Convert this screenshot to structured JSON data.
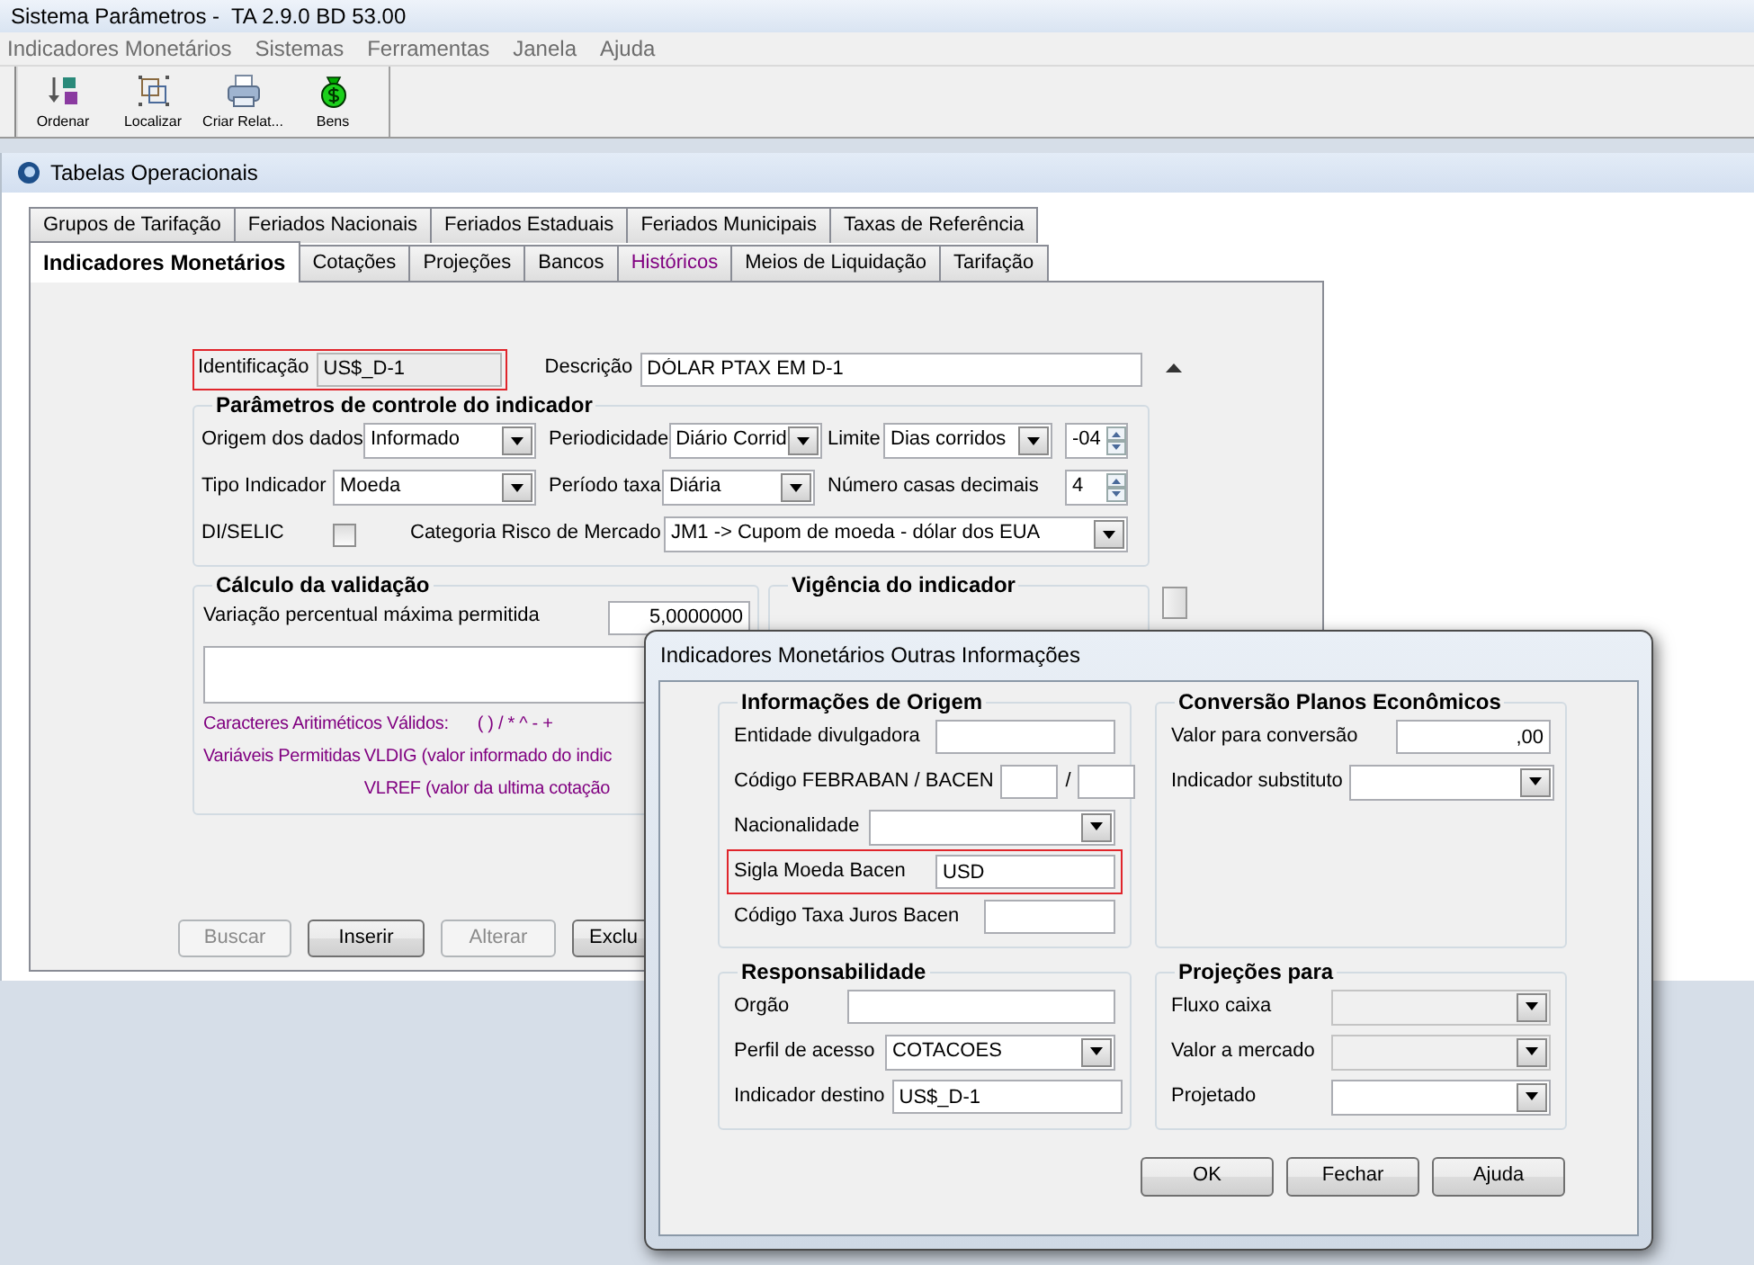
{
  "app_title": "Sistema Parâmetros -  TA 2.9.0 BD 53.00",
  "menu": [
    "Indicadores Monetários",
    "Sistemas",
    "Ferramentas",
    "Janela",
    "Ajuda"
  ],
  "toolbar": [
    {
      "label": "Ordenar",
      "kind": "sort"
    },
    {
      "label": "Localizar",
      "kind": "find"
    },
    {
      "label": "Criar Relat...",
      "kind": "print"
    },
    {
      "label": "Bens",
      "kind": "money"
    }
  ],
  "child_window": {
    "title": "Tabelas Operacionais"
  },
  "tab_rows": [
    [
      {
        "label": "Grupos de Tarifação",
        "selected": false,
        "visited": false
      },
      {
        "label": "Feriados Nacionais",
        "selected": false,
        "visited": false
      },
      {
        "label": "Feriados Estaduais",
        "selected": false,
        "visited": false
      },
      {
        "label": "Feriados Municipais",
        "selected": false,
        "visited": false
      },
      {
        "label": "Taxas de Referência",
        "selected": false,
        "visited": false
      }
    ],
    [
      {
        "label": "Indicadores Monetários",
        "selected": true,
        "visited": false
      },
      {
        "label": "Cotações",
        "selected": false,
        "visited": false
      },
      {
        "label": "Projeções",
        "selected": false,
        "visited": false
      },
      {
        "label": "Bancos",
        "selected": false,
        "visited": false
      },
      {
        "label": "Históricos",
        "selected": false,
        "visited": true
      },
      {
        "label": "Meios de Liquidação",
        "selected": false,
        "visited": false
      },
      {
        "label": "Tarifação",
        "selected": false,
        "visited": false
      }
    ]
  ],
  "header_fields": [
    {
      "kind": "text",
      "label": "Identificação",
      "value": "US$_D-1",
      "readonly": true,
      "highlighted": true
    },
    {
      "kind": "text",
      "label": "Descrição",
      "value": "DÓLAR PTAX EM D-1",
      "readonly": false,
      "highlighted": false
    }
  ],
  "parameters": {
    "title": "Parâmetros de controle do indicador",
    "rows": [
      [
        {
          "kind": "select",
          "label": "Origem dos dados",
          "value": "Informado"
        },
        {
          "kind": "select",
          "label": "Periodicidade",
          "value": "Diário Corrid"
        },
        {
          "kind": "select",
          "label": "Limite",
          "value": "Dias corridos"
        },
        {
          "kind": "spin",
          "value": "-04"
        }
      ],
      [
        {
          "kind": "select",
          "label": "Tipo Indicador",
          "value": "Moeda"
        },
        {
          "kind": "select",
          "label": "Período taxa",
          "value": "Diária"
        },
        {
          "kind": "label",
          "label": "Número casas decimais"
        },
        {
          "kind": "spin",
          "value": "4"
        }
      ],
      [
        {
          "kind": "checkbox",
          "label": "DI/SELIC",
          "checked": false
        },
        {
          "kind": "select",
          "label": "Categoria Risco de Mercado",
          "value": "JM1 -> Cupom de moeda - dólar dos EUA"
        }
      ]
    ]
  },
  "validation": {
    "title": "Cálculo da validação",
    "field": {
      "label": "Variação percentual máxima permitida",
      "value": "5,0000000"
    },
    "notes": [
      {
        "kind": "inline",
        "label": "Caracteres Aritiméticos Válidos:",
        "text": "( ) / * ^ - +"
      },
      {
        "kind": "grid",
        "label": "Variáveis Permitidas",
        "text": "VLDIG  (valor informado do indic"
      },
      {
        "kind": "grid",
        "text": "VLREF (valor da ultima cotação"
      }
    ]
  },
  "validity": {
    "title": "Vigência do indicador"
  },
  "buttons": [
    {
      "label": "Buscar",
      "disabled": true
    },
    {
      "label": "Inserir",
      "disabled": false
    },
    {
      "label": "Alterar",
      "disabled": true
    },
    {
      "label": "Exclu",
      "disabled": false
    }
  ],
  "dialog": {
    "title": "Indicadores Monetários Outras Informações",
    "groups": [
      {
        "title": "Informações de Origem",
        "fields": [
          {
            "kind": "text",
            "label": "Entidade divulgadora",
            "highlighted": false
          },
          {
            "kind": "pair",
            "label": "Código FEBRABAN / BACEN",
            "separator": "/",
            "highlighted": false
          },
          {
            "kind": "select",
            "label": "Nacionalidade",
            "highlighted": false
          },
          {
            "kind": "text",
            "label": "Sigla Moeda Bacen",
            "value": "USD",
            "highlighted": true
          },
          {
            "kind": "text",
            "label": "Código Taxa Juros Bacen",
            "highlighted": false
          }
        ]
      },
      {
        "title": "Conversão Planos Econômicos",
        "fields": [
          {
            "kind": "number",
            "label": "Valor para conversão",
            "value": ",00"
          },
          {
            "kind": "select",
            "label": "Indicador substituto"
          }
        ]
      },
      {
        "title": "Responsabilidade",
        "fields": [
          {
            "kind": "text",
            "label": "Orgão"
          },
          {
            "kind": "select",
            "label": "Perfil de acesso",
            "value": "COTACOES"
          },
          {
            "kind": "text",
            "label": "Indicador destino",
            "value": "US$_D-1"
          }
        ]
      },
      {
        "title": "Projeções para",
        "fields": [
          {
            "kind": "select",
            "label": "Fluxo caixa",
            "disabled": true
          },
          {
            "kind": "select",
            "label": "Valor a mercado",
            "disabled": true
          },
          {
            "kind": "select",
            "label": "Projetado",
            "disabled": false
          }
        ]
      }
    ],
    "buttons": [
      "OK",
      "Fechar",
      "Ajuda"
    ]
  }
}
